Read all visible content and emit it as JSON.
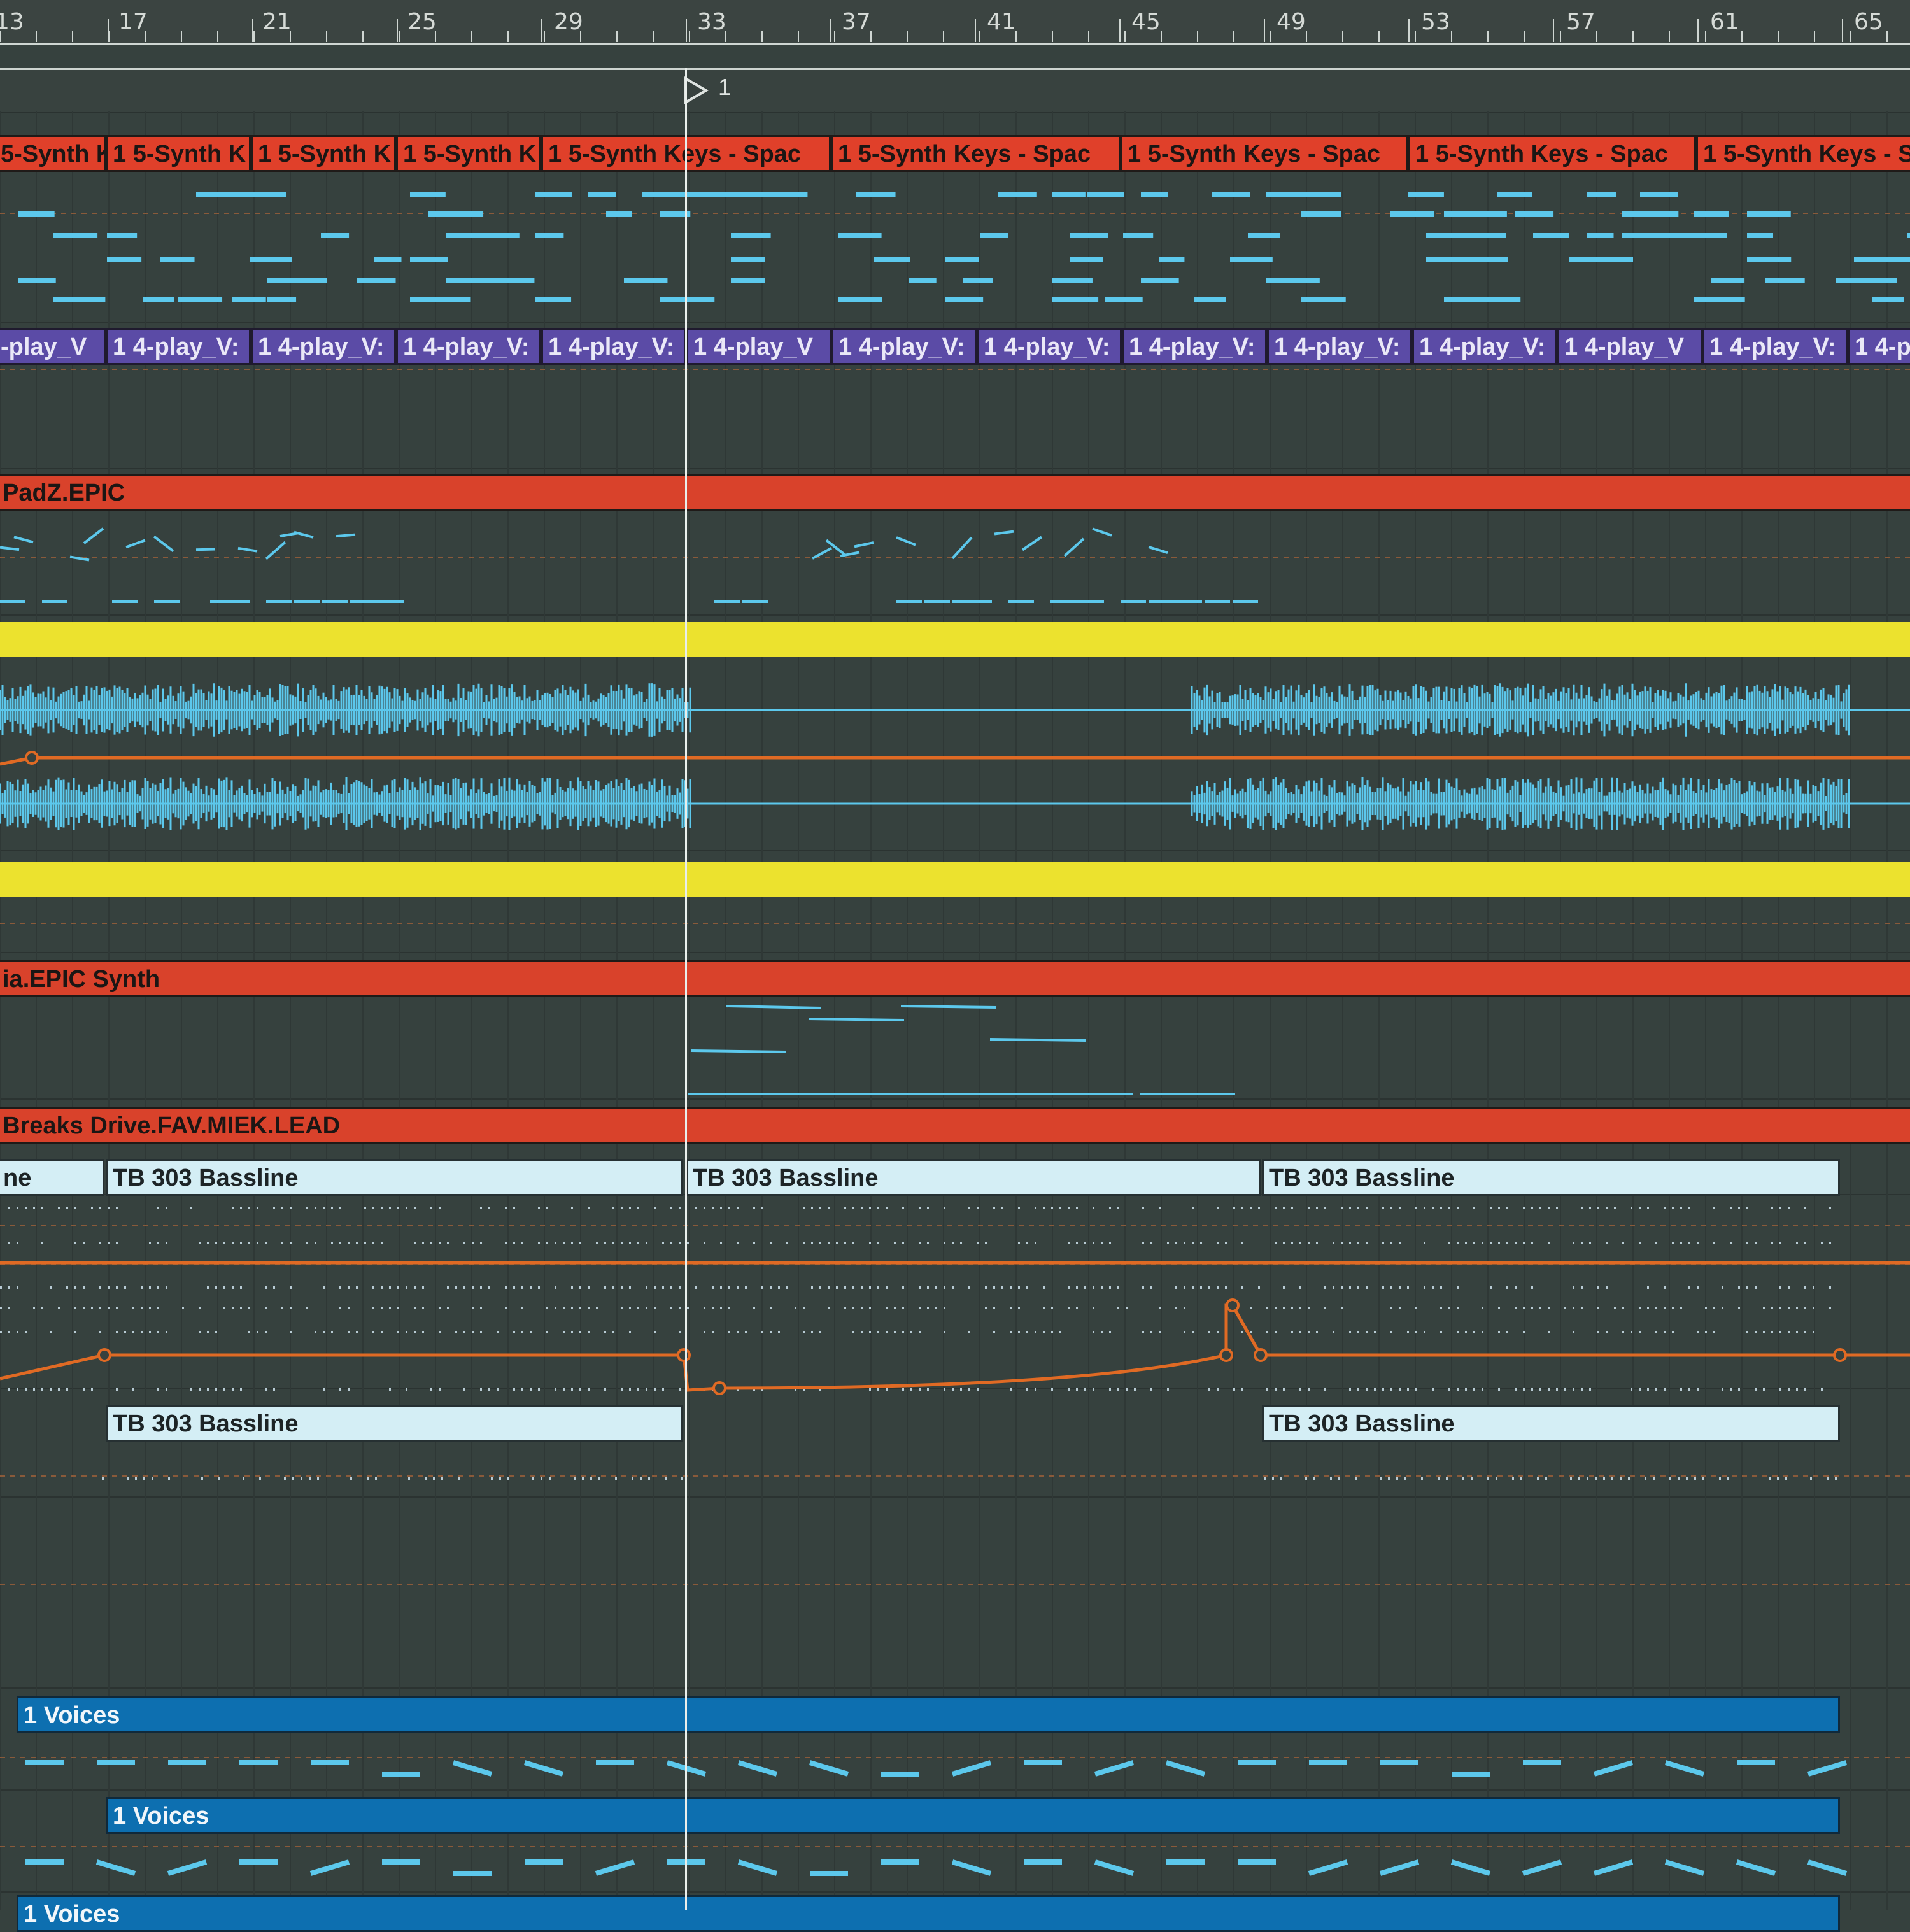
{
  "ruler": {
    "bars": [
      "13",
      "17",
      "21",
      "25",
      "29",
      "33",
      "37",
      "41",
      "45",
      "49",
      "53",
      "57",
      "61",
      "65"
    ]
  },
  "playhead": {
    "marker_label": "1"
  },
  "tracks": {
    "synth_keys": {
      "clips": [
        "5-Synth K",
        "1 5-Synth K",
        "1 5-Synth K",
        "1 5-Synth K",
        "1 5-Synth Keys - Spac",
        "1 5-Synth Keys - Spac",
        "1 5-Synth Keys - Spac",
        "1 5-Synth Keys - Spac",
        "1 5-Synth Keys - Spac"
      ]
    },
    "play_vox": {
      "clips": [
        "-play_V",
        "1 4-play_V:",
        "1 4-play_V:",
        "1 4-play_V:",
        "1 4-play_V:",
        "1 4-play_V",
        "1 4-play_V:",
        "1 4-play_V:",
        "1 4-play_V:",
        "1 4-play_V:",
        "1 4-play_V:",
        "1 4-play_V",
        "1 4-play_V:",
        "1 4-p"
      ]
    },
    "padz": {
      "clip_label": "PadZ.EPIC"
    },
    "audio": {
      "clip_label_top": "",
      "clip_label_bottom": ""
    },
    "epic_synth": {
      "clip_label": "ia.EPIC Synth"
    },
    "lead": {
      "clip_label": "Breaks Drive.FAV.MIEK.LEAD"
    },
    "bassline_a": {
      "clips": [
        "ne",
        "TB 303 Bassline",
        "TB 303 Bassline",
        "TB 303 Bassline"
      ]
    },
    "bassline_b": {
      "clips": [
        "TB 303 Bassline",
        "TB 303 Bassline"
      ]
    },
    "voices": {
      "clips": [
        "1 Voices",
        "1 Voices",
        "1 Voices"
      ]
    }
  },
  "colors": {
    "background": "#36413e",
    "clip_red": "#e0402a",
    "clip_purple": "#5b4ba6",
    "clip_yellow": "#ece22e",
    "clip_bass": "#d4eef5",
    "clip_voice": "#0d6fb0",
    "midi_note": "#5cc8ec",
    "automation": "#e06a24"
  }
}
